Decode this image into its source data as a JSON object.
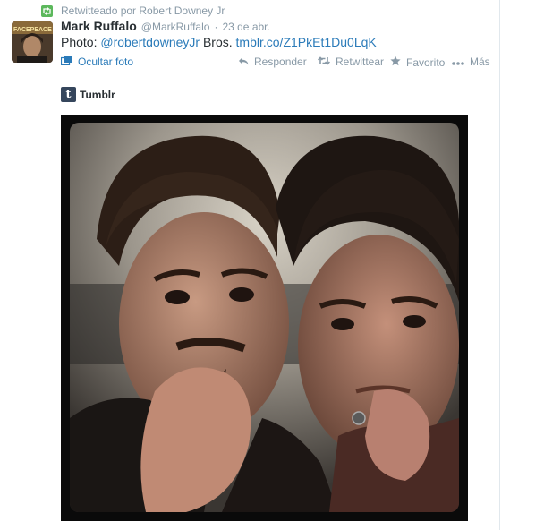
{
  "retweet_context": "Retwitteado por Robert Downey Jr",
  "tweet": {
    "fullname": "Mark Ruffalo",
    "username": "@MarkRuffalo",
    "separator": "·",
    "time": "23 de abr.",
    "text_prefix": "Photo: ",
    "mention": "@robertdowneyJr",
    "text_middle": " Bros. ",
    "url": "tmblr.co/Z1PkEt1Du0LqK",
    "avatar_text": "FACEPEACE"
  },
  "actions": {
    "toggle_photo": "Ocultar foto",
    "reply": "Responder",
    "retweet": "Retwittear",
    "favorite": "Favorito",
    "more": "Más"
  },
  "media": {
    "provider_icon_letter": "t",
    "provider": "Tumblr"
  },
  "colors": {
    "link": "#2b7bb9",
    "meta": "#8899a6",
    "text": "#292f33",
    "retweet_green": "#5cb85c",
    "tumblr_blue": "#35465c"
  },
  "icons": [
    "retweet-badge-icon",
    "photo-icon",
    "reply-icon",
    "retweet-icon",
    "favorite-star-icon",
    "more-dots-icon",
    "tumblr-icon"
  ]
}
